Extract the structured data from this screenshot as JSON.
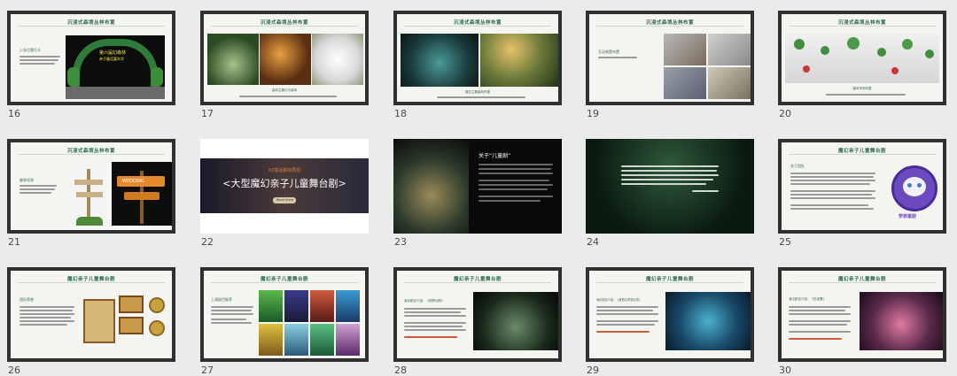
{
  "slides": [
    {
      "num": "16",
      "title": "沉浸式森境丛林布置"
    },
    {
      "num": "17",
      "title": "沉浸式森境丛林布置"
    },
    {
      "num": "18",
      "title": "沉浸式森境丛林布置"
    },
    {
      "num": "19",
      "title": "沉浸式森境丛林布置"
    },
    {
      "num": "20",
      "title": "沉浸式森境丛林布置"
    },
    {
      "num": "21",
      "title": "沉浸式森境丛林布置"
    },
    {
      "num": "22",
      "subtitle": "XX童话森林再现",
      "headline": "<大型魔幻亲子儿童舞台剧>",
      "button": "Read more"
    },
    {
      "num": "23",
      "heading": "关于“儿童剧”"
    },
    {
      "num": "24"
    },
    {
      "num": "25",
      "title": "魔幻亲子儿童舞台剧"
    },
    {
      "num": "26",
      "title": "魔幻亲子儿童舞台剧"
    },
    {
      "num": "27",
      "title": "魔幻亲子儿童舞台剧"
    },
    {
      "num": "28",
      "title": "魔幻亲子儿童舞台剧"
    },
    {
      "num": "29",
      "title": "魔幻亲子儿童舞台剧"
    },
    {
      "num": "30",
      "title": "魔幻亲子儿童舞台剧"
    }
  ],
  "labels": {
    "s16_side": "入场主题打卡",
    "s16_arch": "第六届幻森林",
    "s16_arch2": "亲子童话嘉年华",
    "s17_cap": "森林主题灯光装饰",
    "s18_cap": "魔幻主题森林布置",
    "s19_side": "互动装置布置",
    "s20_cap": "森林吊饰布置",
    "s21_side": "森林导视",
    "s21_sign": "WEDDING",
    "s25_side": "关于团队",
    "s25_logo": "梦想童剧",
    "s26_side": "团队荣誉",
    "s27_side": "上演剧目推荐",
    "s28_side": "演出剧目介绍：《绿野仙踪》",
    "s29_side": "演出剧目介绍：《爱丽丝梦游仙境》",
    "s30_side": "演出剧目介绍：《匹诺曹》"
  }
}
